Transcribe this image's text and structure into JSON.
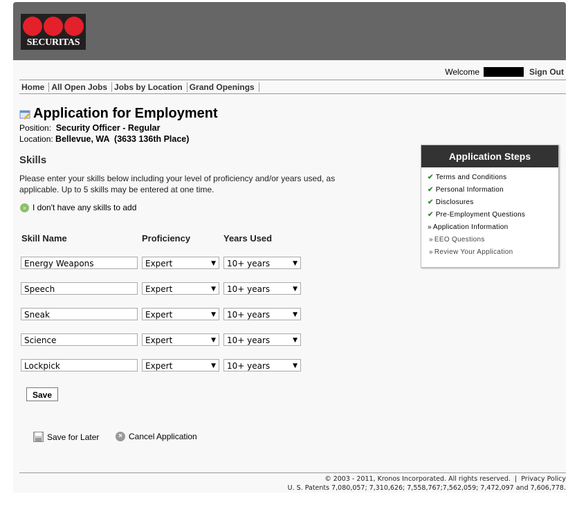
{
  "header": {
    "logo_text": "SECURITAS",
    "welcome": "Welcome",
    "sign_out": "Sign Out"
  },
  "nav": [
    "Home",
    "All Open Jobs",
    "Jobs by Location",
    "Grand Openings"
  ],
  "app": {
    "title": "Application for Employment",
    "position_label": "Position:",
    "position": "Security Officer - Regular",
    "location_label": "Location:",
    "location": "Bellevue, WA  (3633 136th Place)"
  },
  "skills": {
    "heading": "Skills",
    "instructions_1": "Please enter your skills below including your level of proficiency and/or years used, as",
    "instructions_2": "applicable. Up to 5 skills may be entered at one time.",
    "no_skills": "I don't have any skills to add",
    "col_name": "Skill Name",
    "col_prof": "Proficiency",
    "col_years": "Years Used",
    "rows": [
      {
        "name": "Energy Weapons",
        "prof": "Expert",
        "years": "10+ years"
      },
      {
        "name": "Speech",
        "prof": "Expert",
        "years": "10+ years"
      },
      {
        "name": "Sneak",
        "prof": "Expert",
        "years": "10+ years"
      },
      {
        "name": "Science",
        "prof": "Expert",
        "years": "10+ years"
      },
      {
        "name": "Lockpick",
        "prof": "Expert",
        "years": "10+ years"
      }
    ]
  },
  "actions": {
    "save": "Save",
    "save_later": "Save for Later",
    "cancel": "Cancel Application"
  },
  "steps": {
    "title": "Application Steps",
    "items": [
      {
        "label": "Terms and Conditions",
        "done": true
      },
      {
        "label": "Personal Information",
        "done": true
      },
      {
        "label": "Disclosures",
        "done": true
      },
      {
        "label": "Pre-Employment Questions",
        "done": true
      },
      {
        "label": "Application Information",
        "done": false,
        "current": true
      },
      {
        "label": "EEO Questions",
        "done": false
      },
      {
        "label": "Review Your Application",
        "done": false
      }
    ]
  },
  "footer": {
    "copyright": "© 2003 - 2011, Kronos Incorporated. All rights reserved.",
    "sep": "|",
    "privacy": "Privacy Policy",
    "patents": "U. S. Patents 7,080,057; 7,310,626; 7,558,767;7,562,059; 7,472,097 and 7,606,778."
  }
}
